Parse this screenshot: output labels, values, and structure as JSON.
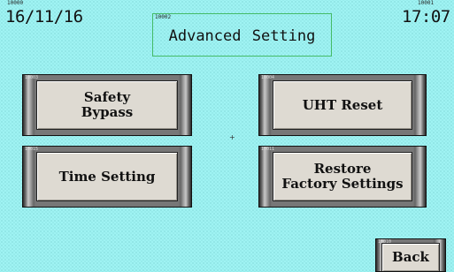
{
  "header": {
    "date": "16/11/16",
    "time": "17:07",
    "date_id": "10000",
    "time_id": "10001"
  },
  "title": {
    "id": "10002",
    "text": "Advanced Setting"
  },
  "buttons": {
    "safety_bypass": {
      "id": "10003",
      "label": "Safety\nBypass"
    },
    "uht_reset": {
      "id": "10004",
      "label": "UHT Reset"
    },
    "time_setting": {
      "id": "10015",
      "label": "Time Setting"
    },
    "restore_factory": {
      "id": "10011",
      "label": "Restore\nFactory Settings"
    },
    "back": {
      "id": "10010",
      "label": "Back"
    }
  },
  "colors": {
    "background": "#9ff3f3",
    "title_border": "#44bb66",
    "button_face": "#dedad2"
  }
}
